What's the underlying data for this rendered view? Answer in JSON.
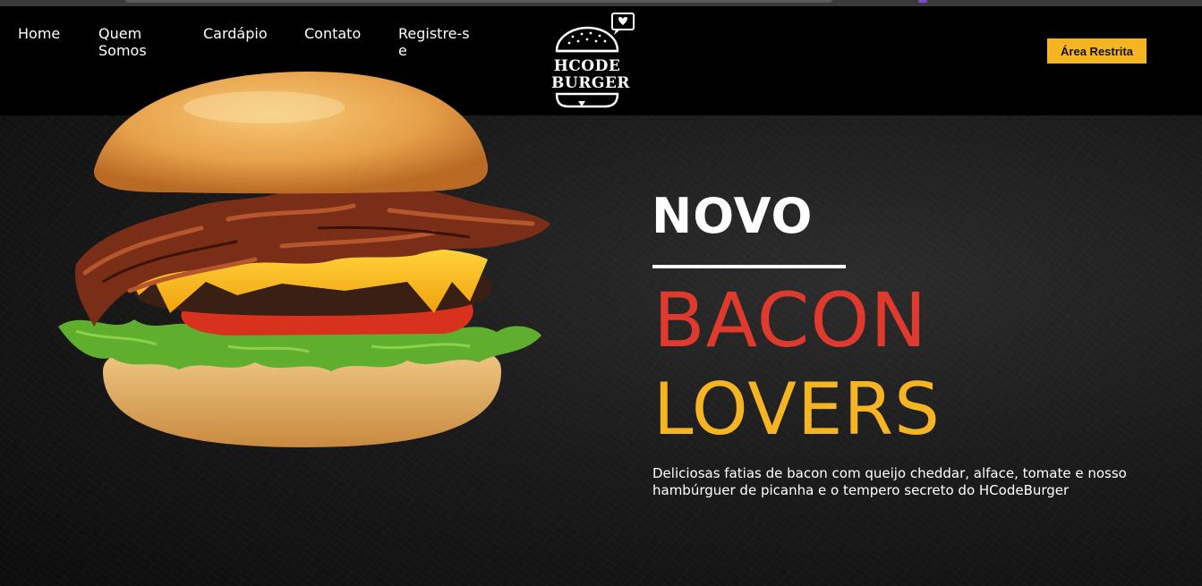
{
  "nav": {
    "items": [
      {
        "label": "Home"
      },
      {
        "label": "Quem Somos"
      },
      {
        "label": "Cardápio"
      },
      {
        "label": "Contato"
      },
      {
        "label": "Registre-se"
      }
    ]
  },
  "logo": {
    "line1": "HCODE",
    "line2": "BURGER",
    "icon": "burger-heart-logo"
  },
  "header": {
    "restricted_label": "Área Restrita"
  },
  "hero": {
    "kicker": "NOVO",
    "title_line1": "BACON",
    "title_line2": "LOVERS",
    "description": "Deliciosas fatias de bacon com queijo cheddar, alface, tomate e nosso hambúrguer de picanha e o tempero secreto do HCodeBurger"
  },
  "colors": {
    "accent_yellow": "#f5b523",
    "accent_red": "#e03a2f",
    "background": "#000000"
  }
}
